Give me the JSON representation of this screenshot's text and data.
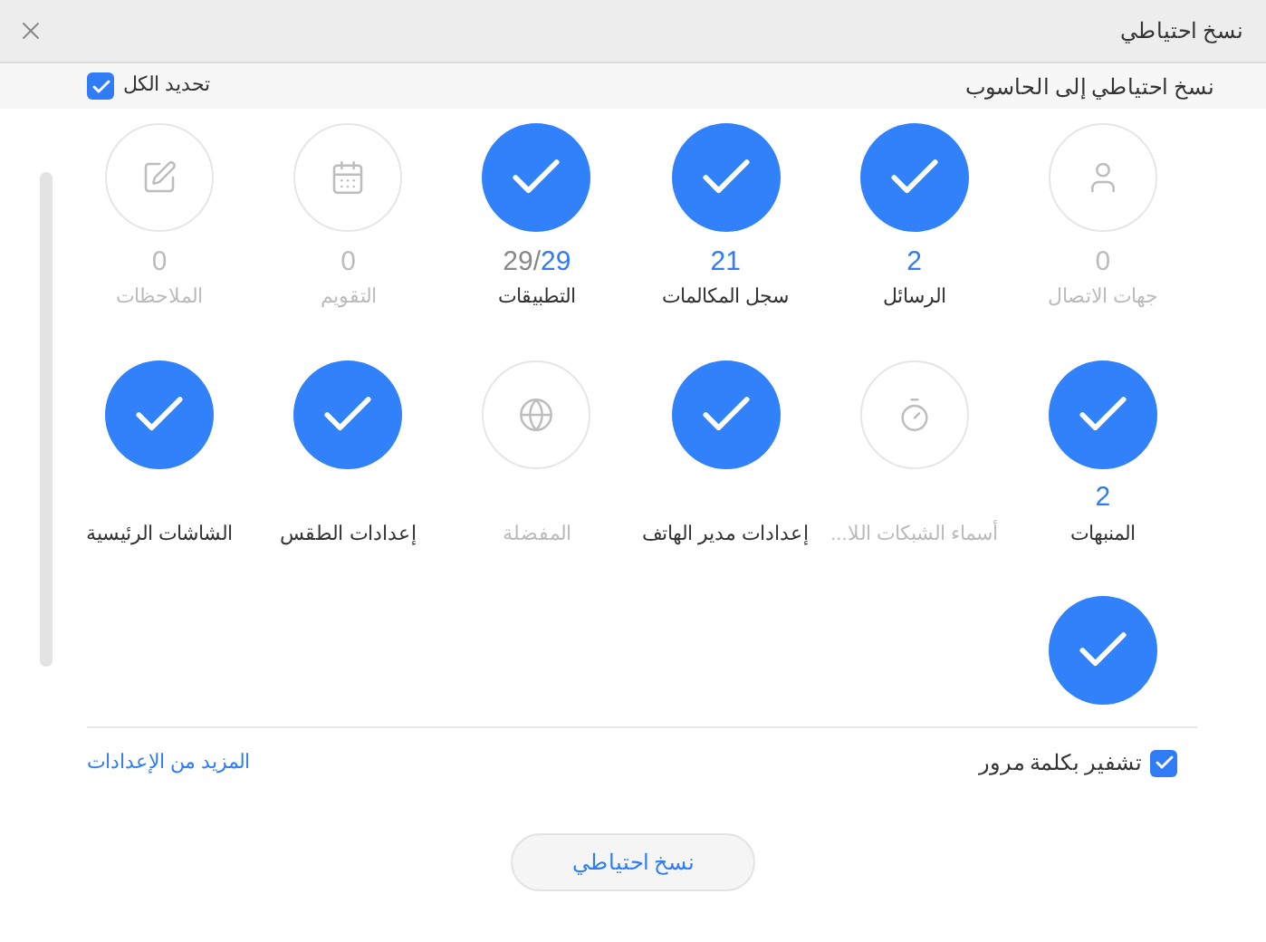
{
  "window": {
    "title": "نسخ احتياطي"
  },
  "header": {
    "title": "نسخ احتياطي إلى الحاسوب",
    "select_all": {
      "label": "تحديد الكل",
      "checked": true
    }
  },
  "items": [
    {
      "label": "جهات الاتصال",
      "count": "0",
      "selected": false,
      "kind": "person"
    },
    {
      "label": "الرسائل",
      "count": "2",
      "selected": true
    },
    {
      "label": "سجل المكالمات",
      "count": "21",
      "selected": true
    },
    {
      "label": "التطبيقات",
      "count": "29",
      "total": "29/",
      "selected": true
    },
    {
      "label": "التقويم",
      "count": "0",
      "selected": false,
      "kind": "calendar"
    },
    {
      "label": "الملاحظات",
      "count": "0",
      "selected": false,
      "kind": "note"
    },
    {
      "label": "المنبهات",
      "count": "2",
      "selected": true
    },
    {
      "label": "أسماء الشبكات اللا...",
      "selected": false,
      "kind": "timer"
    },
    {
      "label": "إعدادات مدير الهاتف",
      "selected": true
    },
    {
      "label": "المفضلة",
      "selected": false,
      "kind": "globe"
    },
    {
      "label": "إعدادات الطقس",
      "selected": true
    },
    {
      "label": "الشاشات الرئيسية",
      "selected": true
    },
    {
      "selected": true
    }
  ],
  "encrypt": {
    "label": "تشفير بكلمة مرور",
    "checked": true
  },
  "more_settings": "المزيد من الإعدادات",
  "backup_button": "نسخ احتياطي"
}
